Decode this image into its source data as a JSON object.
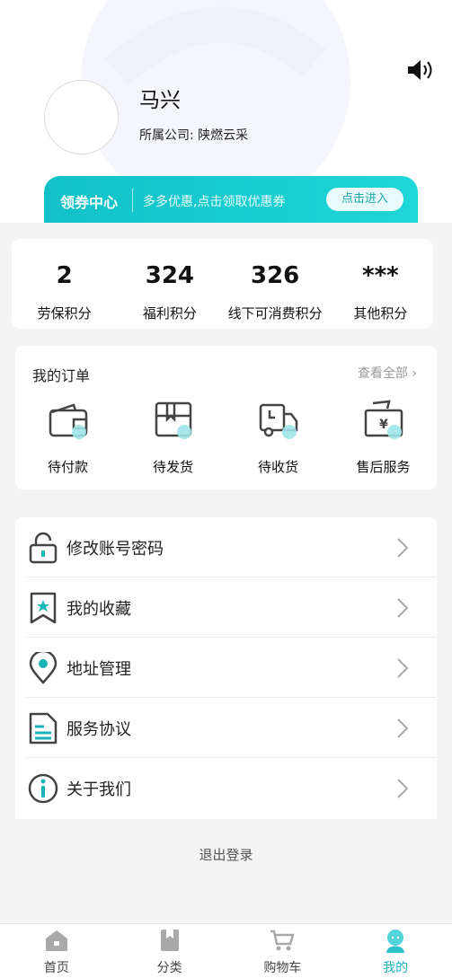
{
  "profile": {
    "name": "马兴",
    "company": "所属公司: 陕燃云采"
  },
  "coupon": {
    "title": "领券中心",
    "desc": "多多优惠,点击领取优惠券",
    "button": "点击进入"
  },
  "points": [
    {
      "value": "2",
      "label": "劳保积分"
    },
    {
      "value": "324",
      "label": "福利积分"
    },
    {
      "value": "326",
      "label": "线下可消费积分"
    },
    {
      "value": "***",
      "label": "其他积分"
    }
  ],
  "orders": {
    "title": "我的订单",
    "view_all": "查看全部 ›",
    "items": [
      {
        "label": "待付款",
        "icon": "wallet-icon"
      },
      {
        "label": "待发货",
        "icon": "package-icon"
      },
      {
        "label": "待收货",
        "icon": "truck-icon"
      },
      {
        "label": "售后服务",
        "icon": "yen-refund-icon"
      }
    ]
  },
  "menu": [
    {
      "label": "修改账号密码",
      "icon": "lock-icon"
    },
    {
      "label": "我的收藏",
      "icon": "bookmark-star-icon"
    },
    {
      "label": "地址管理",
      "icon": "location-pin-icon"
    },
    {
      "label": "服务协议",
      "icon": "document-icon"
    },
    {
      "label": "关于我们",
      "icon": "info-icon"
    }
  ],
  "logout": "退出登录",
  "tabbar": [
    {
      "label": "首页",
      "icon": "home-icon"
    },
    {
      "label": "分类",
      "icon": "category-icon"
    },
    {
      "label": "购物车",
      "icon": "cart-icon"
    },
    {
      "label": "我的",
      "icon": "profile-icon",
      "active": true
    }
  ],
  "colors": {
    "accent": "#18b3b8",
    "coupon_gradient_start": "#12c1c8",
    "coupon_gradient_end": "#1fd6d8"
  }
}
